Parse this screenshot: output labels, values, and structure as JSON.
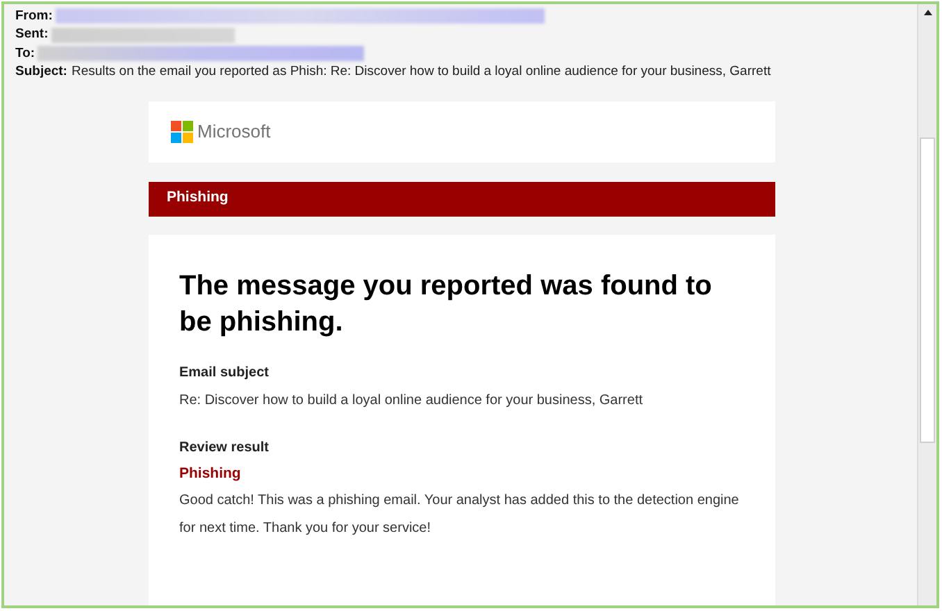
{
  "header": {
    "fields": [
      {
        "label": "From:"
      },
      {
        "label": "Sent:"
      },
      {
        "label": "To:"
      }
    ],
    "subject": {
      "label": "Subject:",
      "value": "Results on the email you reported as Phish: Re: Discover how to build a loyal online audience for your business, Garrett"
    }
  },
  "brand": {
    "name": "Microsoft"
  },
  "banner": {
    "title": "Phishing"
  },
  "message": {
    "heading": "The message you reported was found to be phishing.",
    "sections": [
      {
        "kind": "plain",
        "label": "Email subject",
        "value": "Re: Discover how to build a loyal online audience for your business, Garrett"
      },
      {
        "kind": "verdict",
        "label": "Review result",
        "verdict": "Phishing",
        "value": "Good catch! This was a phishing email. Your analyst has added this to the detection engine for next time. Thank you for your service!"
      }
    ]
  }
}
